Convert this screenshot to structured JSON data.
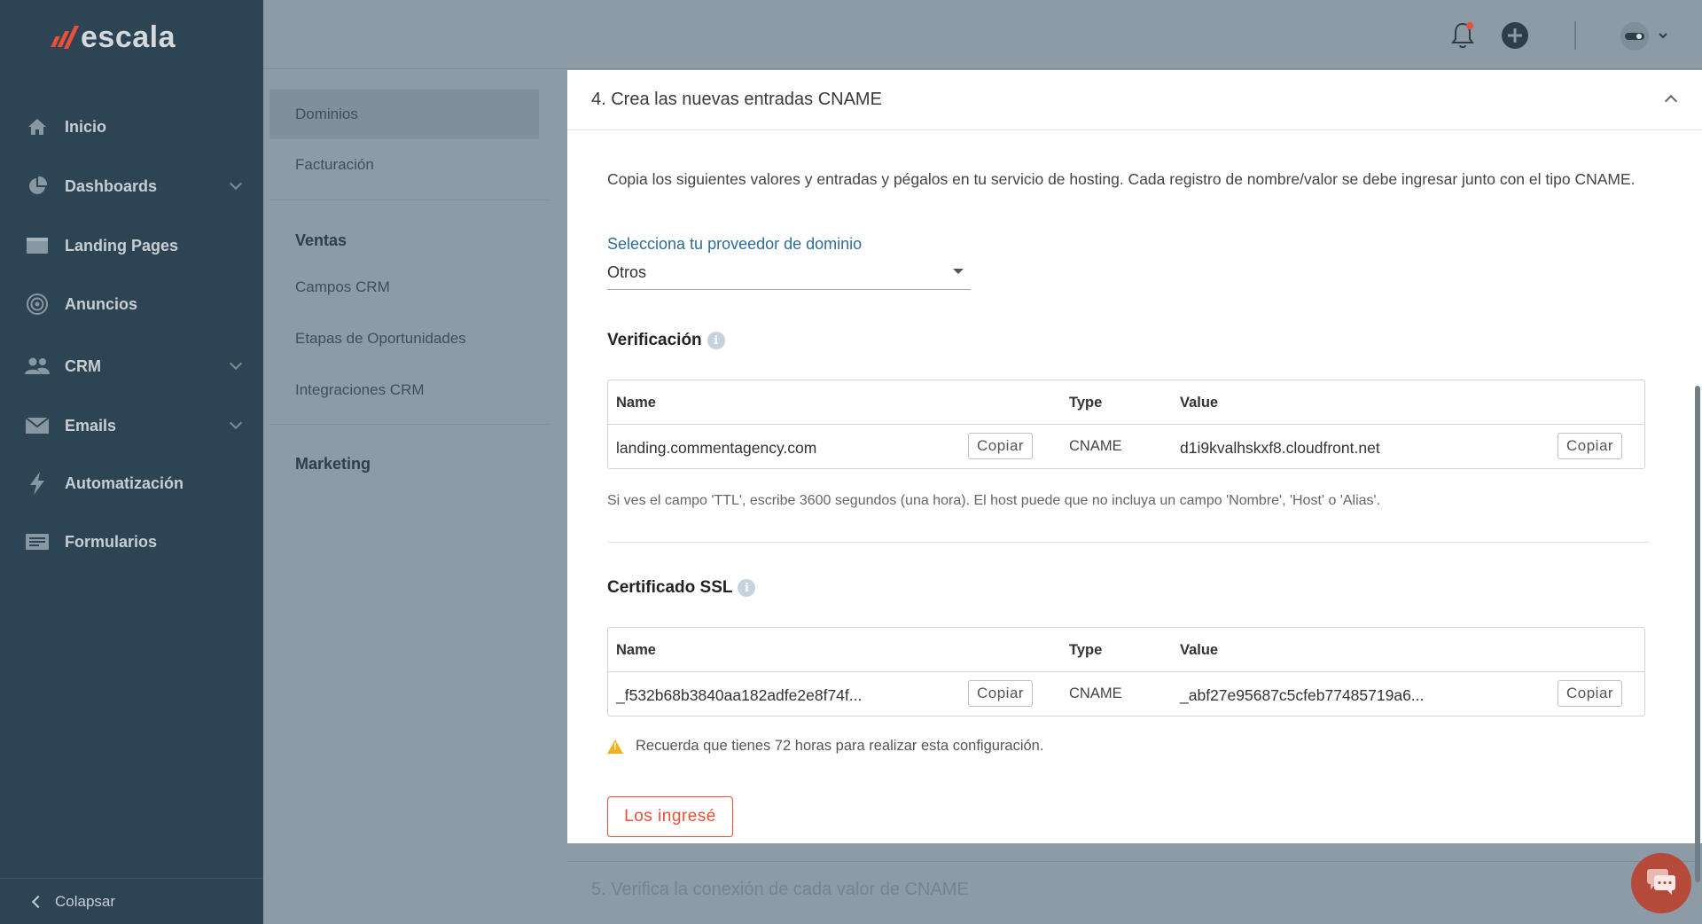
{
  "brand": {
    "name": "escala",
    "accent": "#e8503a"
  },
  "sidebar": {
    "items": [
      {
        "label": "Inicio",
        "icon": "home-icon"
      },
      {
        "label": "Dashboards",
        "icon": "pie-chart-icon",
        "has_submenu": true
      },
      {
        "label": "Landing Pages",
        "icon": "browser-window-icon"
      },
      {
        "label": "Anuncios",
        "icon": "target-icon"
      },
      {
        "label": "CRM",
        "icon": "users-icon",
        "has_submenu": true
      },
      {
        "label": "Emails",
        "icon": "envelope-icon",
        "has_submenu": true
      },
      {
        "label": "Automatización",
        "icon": "lightning-icon"
      },
      {
        "label": "Formularios",
        "icon": "form-icon"
      }
    ],
    "collapse_label": "Colapsar"
  },
  "topbar": {
    "icons": [
      "bell-icon",
      "plus-circle-icon",
      "avatar"
    ]
  },
  "submenu": {
    "group1": [
      "Dominios",
      "Facturación"
    ],
    "ventas_header": "Ventas",
    "ventas_items": [
      "Campos CRM",
      "Etapas de Oportunidades",
      "Integraciones CRM"
    ],
    "marketing_header": "Marketing",
    "active": "Dominios"
  },
  "step4": {
    "title": "4. Crea las nuevas entradas CNAME",
    "description": "Copia los siguientes valores y entradas y pégalos en tu servicio de hosting. Cada registro de nombre/valor se debe ingresar junto con el tipo CNAME.",
    "provider_label": "Selecciona tu proveedor de dominio",
    "provider_value": "Otros",
    "verification": {
      "title": "Verificación",
      "headers": {
        "name": "Name",
        "type": "Type",
        "value": "Value"
      },
      "row": {
        "name": "landing.commentagency.com",
        "type": "CNAME",
        "value": "d1i9kvalhskxf8.cloudfront.net"
      },
      "copy_label": "Copiar",
      "note": "Si ves el campo 'TTL', escribe 3600 segundos (una hora). El host puede que no incluya un campo 'Nombre', 'Host' o 'Alias'."
    },
    "ssl": {
      "title": "Certificado SSL",
      "headers": {
        "name": "Name",
        "type": "Type",
        "value": "Value"
      },
      "row": {
        "name": "_f532b68b3840aa182adfe2e8f74f...",
        "type": "CNAME",
        "value": "_abf27e95687c5cfeb77485719a6..."
      },
      "copy_label": "Copiar"
    },
    "warning": "Recuerda que tienes 72 horas para realizar esta configuración.",
    "done_button": "Los ingresé"
  },
  "step5": {
    "title": "5. Verifica la conexión de cada valor de CNAME"
  }
}
